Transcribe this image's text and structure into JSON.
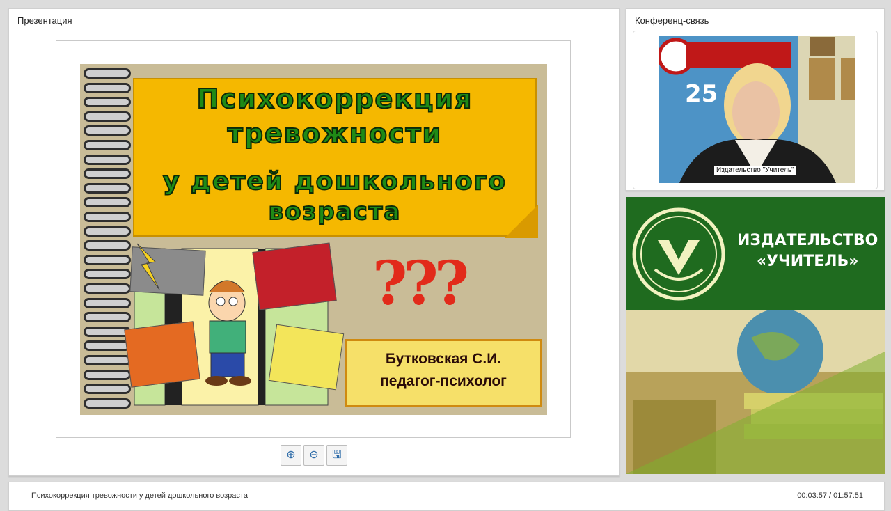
{
  "presentation": {
    "panel_title": "Презентация",
    "slide": {
      "title_line1": "Психокоррекция",
      "title_line2": "тревожности",
      "title_line3": "у детей дошкольного",
      "title_line4": "возраста",
      "question_marks": "???",
      "author_name": "Бутковская С.И.",
      "author_role": "педагог-психолог"
    },
    "toolbar": {
      "zoom_in_icon": "zoom-in-icon",
      "zoom_out_icon": "zoom-out-icon",
      "save_icon": "save-icon"
    }
  },
  "conference": {
    "panel_title": "Конференц-связь",
    "video_caption": "Издательство \"Учитель\"",
    "backdrop_text": "25"
  },
  "advert": {
    "line1": "ИЗДАТЕЛЬСТВО",
    "line2": "«УЧИТЕЛЬ»"
  },
  "status_bar": {
    "title": "Психокоррекция тревожности у детей дошкольного возраста",
    "time": "00:03:57 / 01:57:51"
  },
  "colors": {
    "brand_green": "#1f6b1f",
    "title_yellow": "#f5b800"
  }
}
